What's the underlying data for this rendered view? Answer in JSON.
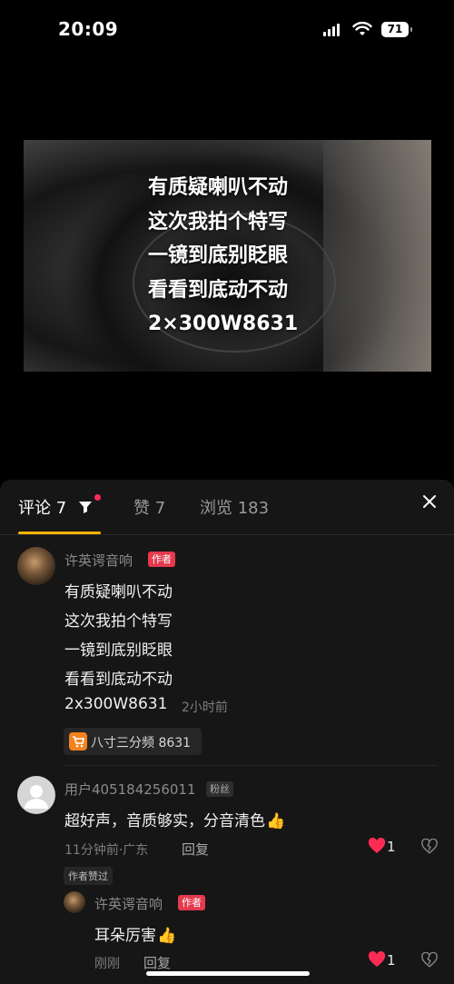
{
  "status": {
    "time": "20:09",
    "battery": "71"
  },
  "video": {
    "caption_lines": [
      "有质疑喇叭不动",
      "这次我拍个特写",
      "一镜到底别眨眼",
      "看看到底动不动",
      "2×300W8631"
    ]
  },
  "tabs": {
    "comments": "评论 7",
    "likes": "赞 7",
    "views": "浏览 183"
  },
  "comments": [
    {
      "user": "许英谔音响",
      "badge": "作者",
      "lines": [
        "有质疑喇叭不动",
        "这次我拍个特写",
        "一镜到底别眨眼",
        "看看到底动不动",
        "2x300W8631"
      ],
      "time": "2小时前",
      "product": "八寸三分频 8631"
    },
    {
      "user": "用户405184256011",
      "badge": "粉丝",
      "text": "超好声，音质够实，分音清色",
      "meta": "11分钟前·广东",
      "reply": "回复",
      "likes": "1",
      "liked_by_author": "作者赞过",
      "replies": [
        {
          "user": "许英谔音响",
          "badge": "作者",
          "text": "耳朵厉害",
          "meta": "刚刚",
          "reply": "回复",
          "likes": "1"
        }
      ]
    }
  ],
  "colors": {
    "accent": "#f5b400",
    "author_badge": "#e53a4e",
    "heart": "#fe2c55",
    "panel_bg": "#161616"
  }
}
